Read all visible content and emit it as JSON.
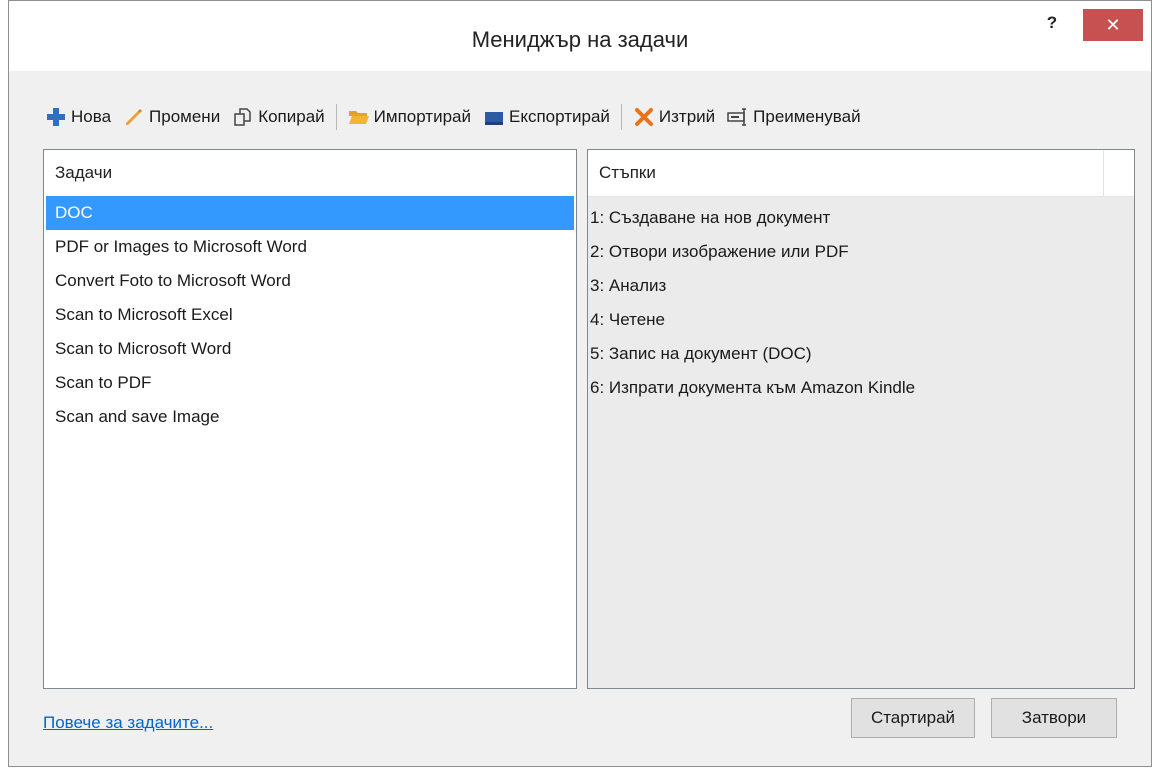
{
  "window": {
    "title": "Мениджър на задачи",
    "help_label": "?",
    "close_label": "✕"
  },
  "toolbar": {
    "items": [
      {
        "label": "Нова",
        "icon": "plus-icon",
        "color": "#2f6fc2"
      },
      {
        "label": "Промени",
        "icon": "pencil-icon",
        "color": "#f0a030"
      },
      {
        "label": "Копирай",
        "icon": "copy-icon",
        "color": "#444444"
      },
      {
        "label": "Импортирай",
        "icon": "folder-icon",
        "color": "#f2b533"
      },
      {
        "label": "Експортирай",
        "icon": "drive-icon",
        "color": "#2d5aa8"
      },
      {
        "label": "Изтрий",
        "icon": "delete-x-icon",
        "color": "#e8731a"
      },
      {
        "label": "Преименувай",
        "icon": "rename-icon",
        "color": "#444444"
      }
    ]
  },
  "tasks": {
    "header": "Задачи",
    "items": [
      "DOC",
      "PDF or Images to Microsoft Word",
      "Convert Foto to Microsoft Word",
      "Scan to Microsoft Excel",
      "Scan to Microsoft Word",
      "Scan to PDF",
      "Scan and save Image"
    ],
    "selected_index": 0
  },
  "steps": {
    "header": "Стъпки",
    "items": [
      "1: Създаване на нов документ",
      "2: Отвори изображение или PDF",
      "3: Анализ",
      "4: Четене",
      "5: Запис на документ (DOC)",
      "6: Изпрати документа към Amazon Kindle"
    ]
  },
  "footer": {
    "more_link": "Повече за задачите...",
    "start_label": "Стартирай",
    "close_label": "Затвори"
  },
  "colors": {
    "selection": "#3399ff",
    "close_button": "#c75050",
    "link": "#0066cc"
  }
}
